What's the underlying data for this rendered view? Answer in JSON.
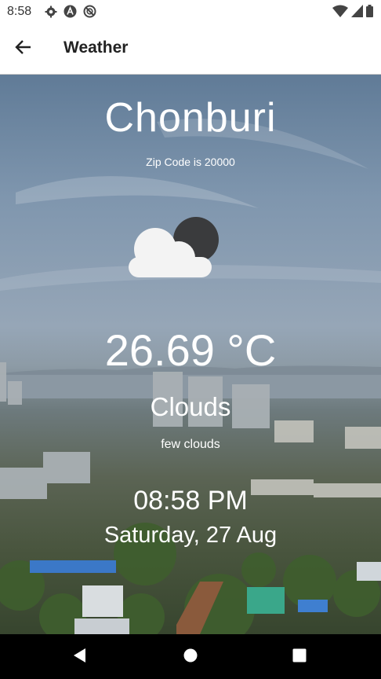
{
  "status_bar": {
    "time": "8:58",
    "left_icons": [
      "gear-icon",
      "a-icon",
      "no-sync-icon"
    ],
    "right_icons": [
      "wifi-icon",
      "signal-icon",
      "battery-icon"
    ]
  },
  "app_bar": {
    "back_icon": "arrow-back-icon",
    "title": "Weather"
  },
  "weather": {
    "city": "Chonburi",
    "zip": "Zip Code is 20000",
    "icon": "cloud-moon-icon",
    "temperature": "26.69 °C",
    "main": "Clouds",
    "description": "few clouds",
    "time": "08:58 PM",
    "date": "Saturday, 27 Aug"
  },
  "nav_bar": {
    "buttons": [
      "back-triangle-icon",
      "home-circle-icon",
      "recents-square-icon"
    ]
  },
  "colors": {
    "sky_top": "#607b97",
    "city_bottom": "#37452e",
    "moon": "#3a3b3d",
    "cloud": "#f3f3f3"
  }
}
